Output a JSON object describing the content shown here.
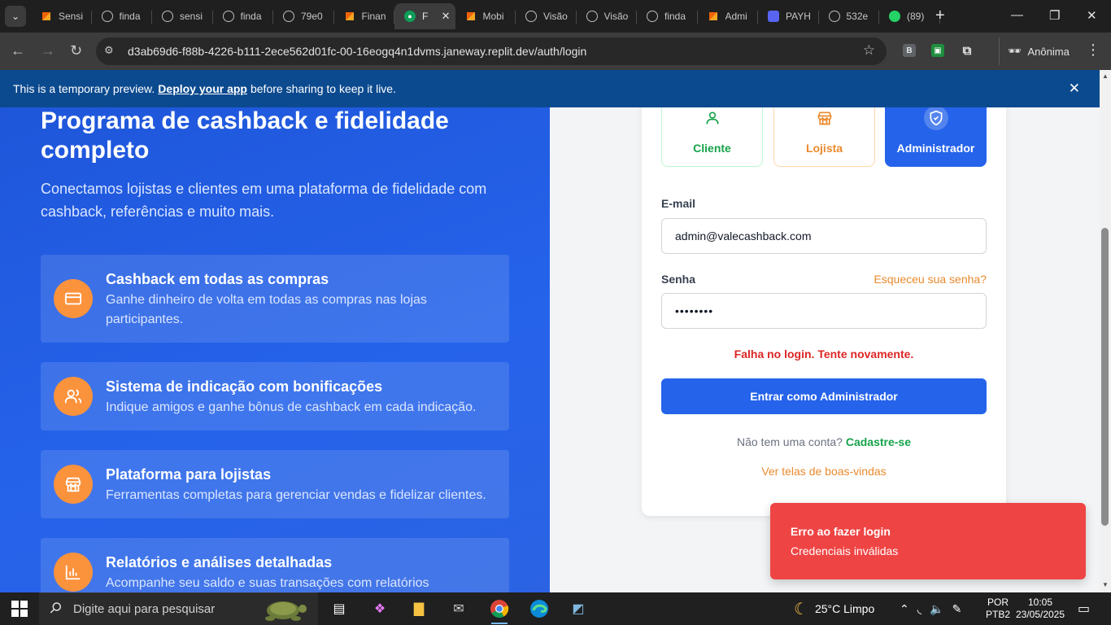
{
  "browser": {
    "tabs": [
      {
        "label": "Sensi",
        "icon": "replit"
      },
      {
        "label": "finda",
        "icon": "globe"
      },
      {
        "label": "sensi",
        "icon": "globe"
      },
      {
        "label": "finda",
        "icon": "globe"
      },
      {
        "label": "79e0",
        "icon": "globe"
      },
      {
        "label": "Finan",
        "icon": "replit"
      },
      {
        "label": "F",
        "icon": "green",
        "active": true
      },
      {
        "label": "Mobi",
        "icon": "replit"
      },
      {
        "label": "Visão",
        "icon": "globe"
      },
      {
        "label": "Visão",
        "icon": "globe"
      },
      {
        "label": "finda",
        "icon": "globe"
      },
      {
        "label": "Admi",
        "icon": "replit"
      },
      {
        "label": "PAYH",
        "icon": "discord"
      },
      {
        "label": "532e",
        "icon": "globe"
      },
      {
        "label": "(89)",
        "icon": "whatsapp"
      }
    ],
    "url": "d3ab69d6-f88b-4226-b111-2ece562d01fc-00-16eogq4n1dvms.janeway.replit.dev/auth/login",
    "profile_label": "Anônima",
    "ext_b_label": "B"
  },
  "banner": {
    "text_before": "This is a temporary preview.",
    "link": "Deploy your app",
    "text_after": "before sharing to keep it live."
  },
  "hero": {
    "title": "Programa de cashback e fidelidade completo",
    "subtitle": "Conectamos lojistas e clientes em uma plataforma de fidelidade com cashback, referências e muito mais.",
    "features": [
      {
        "title": "Cashback em todas as compras",
        "desc": "Ganhe dinheiro de volta em todas as compras nas lojas participantes.",
        "icon": "credit-card-icon"
      },
      {
        "title": "Sistema de indicação com bonificações",
        "desc": "Indique amigos e ganhe bônus de cashback em cada indicação.",
        "icon": "users-icon"
      },
      {
        "title": "Plataforma para lojistas",
        "desc": "Ferramentas completas para gerenciar vendas e fidelizar clientes.",
        "icon": "store-icon"
      },
      {
        "title": "Relatórios e análises detalhadas",
        "desc": "Acompanhe seu saldo e suas transações com relatórios completos.",
        "icon": "bar-chart-icon"
      }
    ]
  },
  "login": {
    "roles": {
      "cliente": "Cliente",
      "lojista": "Lojista",
      "admin": "Administrador"
    },
    "email_label": "E-mail",
    "email_value": "admin@valecashback.com",
    "password_label": "Senha",
    "password_value": "••••••••",
    "forgot": "Esqueceu sua senha?",
    "error": "Falha no login. Tente novamente.",
    "submit": "Entrar como Administrador",
    "signup_text": "Não tem uma conta?",
    "signup_link": "Cadastre-se",
    "welcome_link": "Ver telas de boas-vindas"
  },
  "toast": {
    "title": "Erro ao fazer login",
    "desc": "Credenciais inválidas"
  },
  "taskbar": {
    "search_placeholder": "Digite aqui para pesquisar",
    "weather": "25°C  Limpo",
    "lang1": "POR",
    "lang2": "PTB2",
    "time": "10:05",
    "date": "23/05/2025"
  },
  "colors": {
    "primary": "#2563eb",
    "accent_orange": "#fb923c",
    "success": "#16a34a",
    "error": "#ef4444"
  }
}
